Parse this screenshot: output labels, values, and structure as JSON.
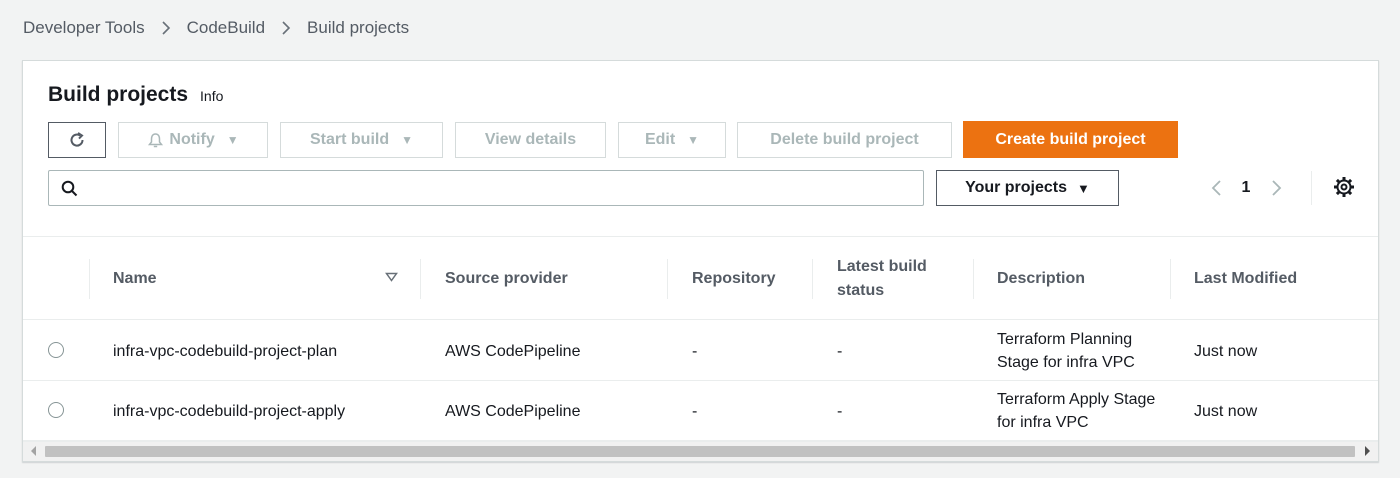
{
  "breadcrumb": [
    "Developer Tools",
    "CodeBuild",
    "Build projects"
  ],
  "header": {
    "title": "Build projects",
    "info": "Info"
  },
  "toolbar": {
    "refresh_icon": "refresh-icon",
    "notify": "Notify",
    "start_build": "Start build",
    "view_details": "View details",
    "edit": "Edit",
    "delete": "Delete build project",
    "create": "Create build project"
  },
  "search": {
    "value": "",
    "placeholder": ""
  },
  "filter": {
    "selected": "Your projects"
  },
  "pagination": {
    "current_page": "1"
  },
  "table": {
    "columns": [
      "Name",
      "Source provider",
      "Repository",
      "Latest build status",
      "Description",
      "Last Modified"
    ],
    "rows": [
      {
        "name": "infra-vpc-codebuild-project-plan",
        "source_provider": "AWS CodePipeline",
        "repository": "-",
        "latest_build_status": "-",
        "description": "Terraform Planning Stage for infra VPC",
        "last_modified": "Just now"
      },
      {
        "name": "infra-vpc-codebuild-project-apply",
        "source_provider": "AWS CodePipeline",
        "repository": "-",
        "latest_build_status": "-",
        "description": "Terraform Apply Stage for infra VPC",
        "last_modified": "Just now"
      }
    ]
  },
  "colors": {
    "primary": "#ec7211",
    "text": "#16191f",
    "muted": "#545b64",
    "disabled": "#aab7b8",
    "background": "#f2f3f3"
  }
}
